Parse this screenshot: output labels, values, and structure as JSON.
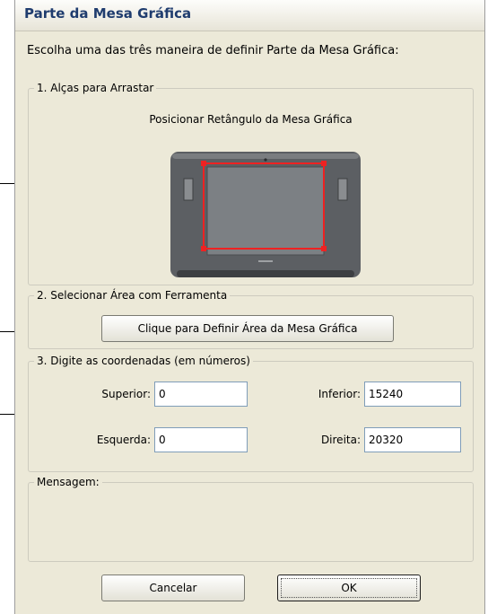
{
  "dialog": {
    "title": "Parte da Mesa Gráfica",
    "instruction": "Escolha uma das três maneira de definir Parte da Mesa Gráfica:"
  },
  "section1": {
    "legend": "1. Alças para Arrastar",
    "caption": "Posicionar Retângulo da Mesa Gráfica"
  },
  "section2": {
    "legend": "2. Selecionar Área com Ferramenta",
    "button_label": "Clique para Definir Área da Mesa Gráfica"
  },
  "section3": {
    "legend": "3. Digite as coordenadas (em números)",
    "top_label": "Superior:",
    "top_value": "0",
    "bottom_label": "Inferior:",
    "bottom_value": "15240",
    "left_label": "Esquerda:",
    "left_value": "0",
    "right_label": "Direita:",
    "right_value": "20320"
  },
  "message": {
    "legend": "Mensagem:"
  },
  "buttons": {
    "cancel": "Cancelar",
    "ok": "OK"
  },
  "colors": {
    "selection": "#ee2222",
    "dialog_bg": "#ece9d8",
    "tablet_body": "#5c5f63"
  }
}
